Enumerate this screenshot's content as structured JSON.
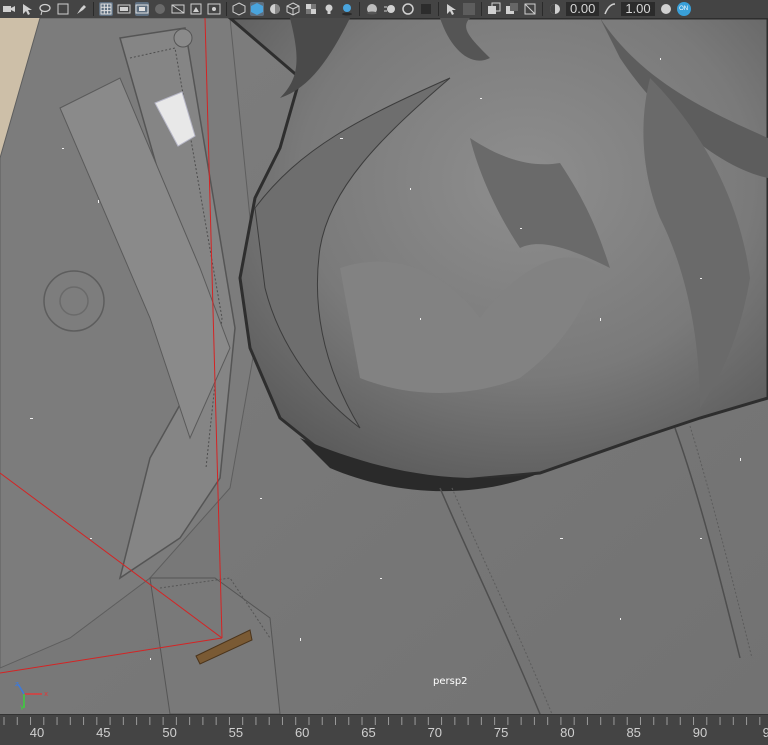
{
  "toolbar": {
    "icons_left": [
      "select-icon",
      "lasso-icon",
      "paint-icon",
      "move-icon",
      "rotate-icon",
      "scale-icon"
    ],
    "icons_mid": [
      "grid-icon",
      "film-gate-icon",
      "resolution-gate-icon",
      "gate-mask-icon",
      "field-chart-icon",
      "safe-action-icon",
      "safe-title-icon",
      "frame-icon"
    ],
    "icons_right": [
      "wireframe-icon",
      "smooth-shade-icon",
      "shaded-wire-icon",
      "textured-icon",
      "lights-icon",
      "shadows-icon",
      "ambient-occlusion-icon",
      "motion-blur-icon",
      "anti-aliasing-icon",
      "depth-of-field-icon"
    ],
    "field_exposure": "0.00",
    "field_gamma": "1.00",
    "toggle_label": "ON",
    "colors": {
      "toolbar_bg": "#444444",
      "active_bg": "#5d6e7f",
      "toggle_blue": "#39a0d9",
      "viewport_bg": "#7a7a7a",
      "camera_line": "#d42424"
    }
  },
  "viewport": {
    "camera_name": "persp2",
    "gizmo": {
      "x": "x",
      "y": "y",
      "z": "z"
    }
  },
  "timeslider": {
    "ticks": [
      "40",
      "45",
      "50",
      "55",
      "60",
      "65",
      "70",
      "75",
      "80",
      "85",
      "90",
      "9"
    ]
  }
}
